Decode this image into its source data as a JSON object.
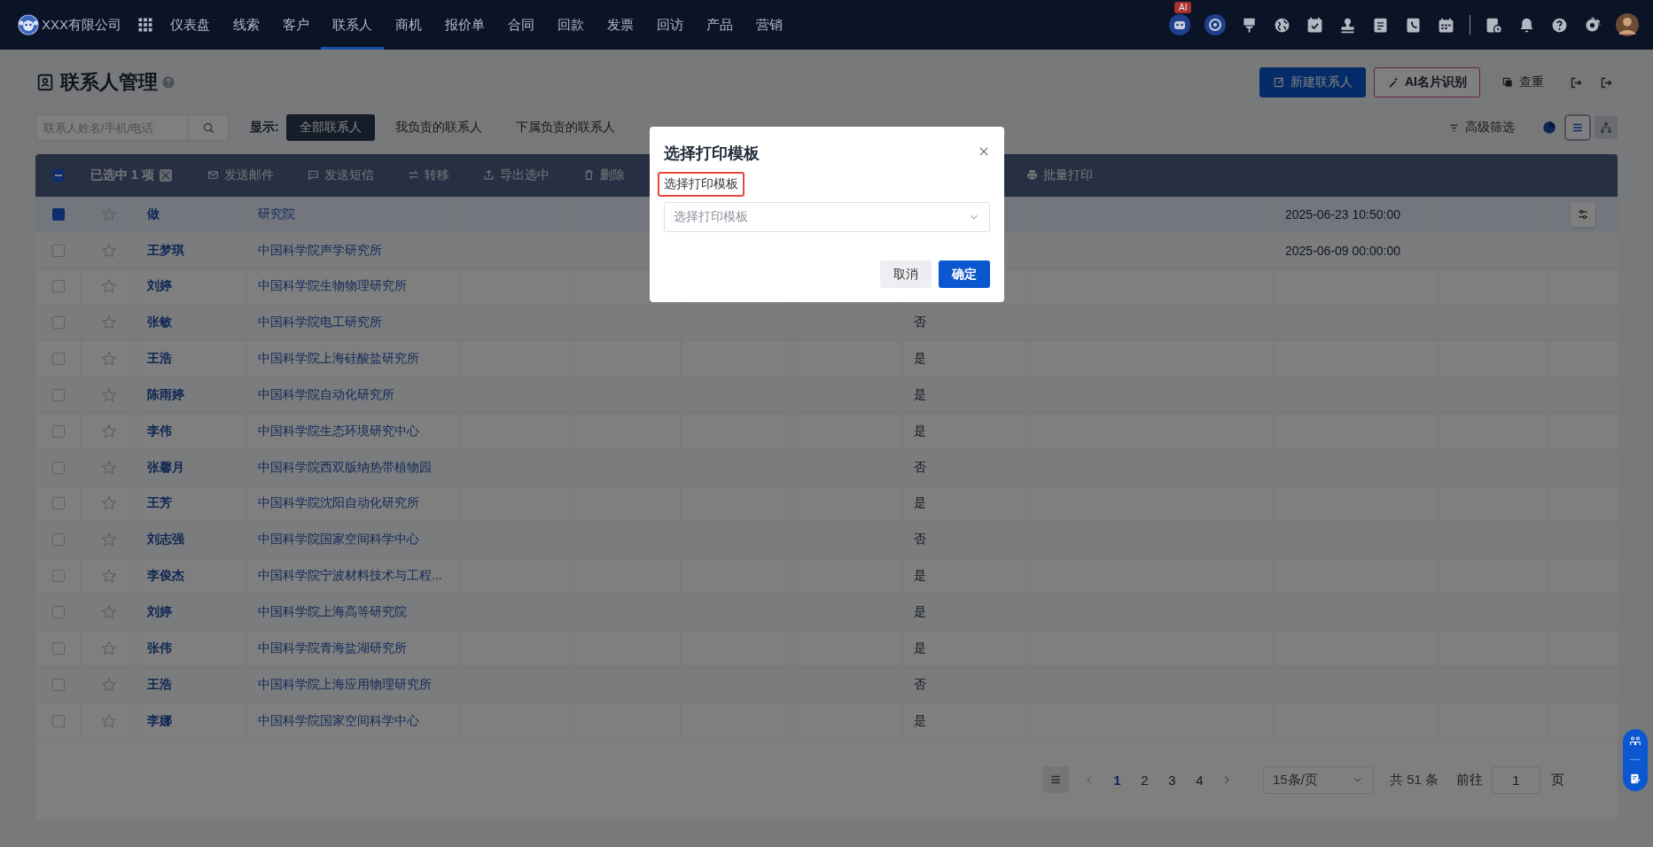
{
  "nav": {
    "logo_text": "XXX有限公司",
    "ai_badge": "AI",
    "menu": [
      {
        "label": "仪表盘",
        "selected": false
      },
      {
        "label": "线索",
        "selected": false
      },
      {
        "label": "客户",
        "selected": false
      },
      {
        "label": "联系人",
        "selected": true
      },
      {
        "label": "商机",
        "selected": false
      },
      {
        "label": "报价单",
        "selected": false
      },
      {
        "label": "合同",
        "selected": false
      },
      {
        "label": "回款",
        "selected": false
      },
      {
        "label": "发票",
        "selected": false
      },
      {
        "label": "回访",
        "selected": false
      },
      {
        "label": "产品",
        "selected": false
      },
      {
        "label": "营销",
        "selected": false
      }
    ]
  },
  "page": {
    "title": "联系人管理",
    "buttons": [
      {
        "kind": "primary",
        "label": "新建联系人"
      },
      {
        "kind": "ai",
        "label": "AI名片识别"
      },
      {
        "kind": "plain",
        "label": "查重"
      }
    ]
  },
  "filters": {
    "search_placeholder": "联系人姓名/手机/电话",
    "show_label": "显示:",
    "advanced_filter": "高级筛选",
    "views": [
      {
        "label": "全部联系人",
        "selected": true
      },
      {
        "label": "我负责的联系人",
        "selected": false
      },
      {
        "label": "下属负责的联系人",
        "selected": false
      }
    ],
    "view_modes": [
      {
        "kind": "list",
        "selected": true
      },
      {
        "kind": "tree",
        "selected": false
      }
    ]
  },
  "selection_bar": {
    "indeterminate": true,
    "count_text": "已选中 1 项",
    "actions": [
      {
        "kind": "mail",
        "label": "发送邮件"
      },
      {
        "kind": "sms",
        "label": "发送短信"
      },
      {
        "kind": "transfer",
        "label": "转移"
      },
      {
        "kind": "export",
        "label": "导出选中"
      },
      {
        "kind": "delete",
        "label": "删除"
      },
      {
        "kind": "print",
        "label": "批量打印"
      }
    ]
  },
  "table": {
    "rows": [
      {
        "checked": true,
        "starred": false,
        "name": "做",
        "company": "研究院",
        "date": "2025-06-23 10:50:00"
      },
      {
        "checked": false,
        "starred": false,
        "name": "王梦琪",
        "company": "中国科学院声学研究所",
        "date": "2025-06-09 00:00:00"
      },
      {
        "checked": false,
        "starred": false,
        "name": "刘婷",
        "company": "中国科学院生物物理研究所"
      },
      {
        "checked": false,
        "starred": false,
        "name": "张敏",
        "company": "中国科学院电工研究所",
        "flag": "否"
      },
      {
        "checked": false,
        "starred": false,
        "name": "王浩",
        "company": "中国科学院上海硅酸盐研究所",
        "flag": "是"
      },
      {
        "checked": false,
        "starred": false,
        "name": "陈雨婷",
        "company": "中国科学院自动化研究所",
        "flag": "是"
      },
      {
        "checked": false,
        "starred": false,
        "name": "李伟",
        "company": "中国科学院生态环境研究中心",
        "flag": "是"
      },
      {
        "checked": false,
        "starred": false,
        "name": "张馨月",
        "company": "中国科学院西双版纳热带植物园",
        "flag": "否"
      },
      {
        "checked": false,
        "starred": false,
        "name": "王芳",
        "company": "中国科学院沈阳自动化研究所",
        "flag": "是"
      },
      {
        "checked": false,
        "starred": false,
        "name": "刘志强",
        "company": "中国科学院国家空间科学中心",
        "flag": "否"
      },
      {
        "checked": false,
        "starred": false,
        "name": "李俊杰",
        "company": "中国科学院宁波材料技术与工程...",
        "flag": "是"
      },
      {
        "checked": false,
        "starred": false,
        "name": "刘婷",
        "company": "中国科学院上海高等研究院",
        "flag": "是"
      },
      {
        "checked": false,
        "starred": false,
        "name": "张伟",
        "company": "中国科学院青海盐湖研究所",
        "flag": "是"
      },
      {
        "checked": false,
        "starred": false,
        "name": "王浩",
        "company": "中国科学院上海应用物理研究所",
        "flag": "否"
      },
      {
        "checked": false,
        "starred": false,
        "name": "李娜",
        "company": "中国科学院国家空间科学中心",
        "flag": "是"
      }
    ]
  },
  "pagination": {
    "pages": [
      {
        "label": "1",
        "selected": true
      },
      {
        "label": "2",
        "selected": false
      },
      {
        "label": "3",
        "selected": false
      },
      {
        "label": "4",
        "selected": false
      }
    ],
    "page_size": "15条/页",
    "total": "共 51 条",
    "goto_label": "前往",
    "goto_value": "1",
    "page_unit": "页"
  },
  "modal": {
    "title": "选择打印模板",
    "field_label": "选择打印模板",
    "field_highlighted": true,
    "select_placeholder": "选择打印模板",
    "buttons": [
      {
        "kind": "cancel",
        "label": "取消"
      },
      {
        "kind": "confirm",
        "label": "确定"
      }
    ]
  }
}
